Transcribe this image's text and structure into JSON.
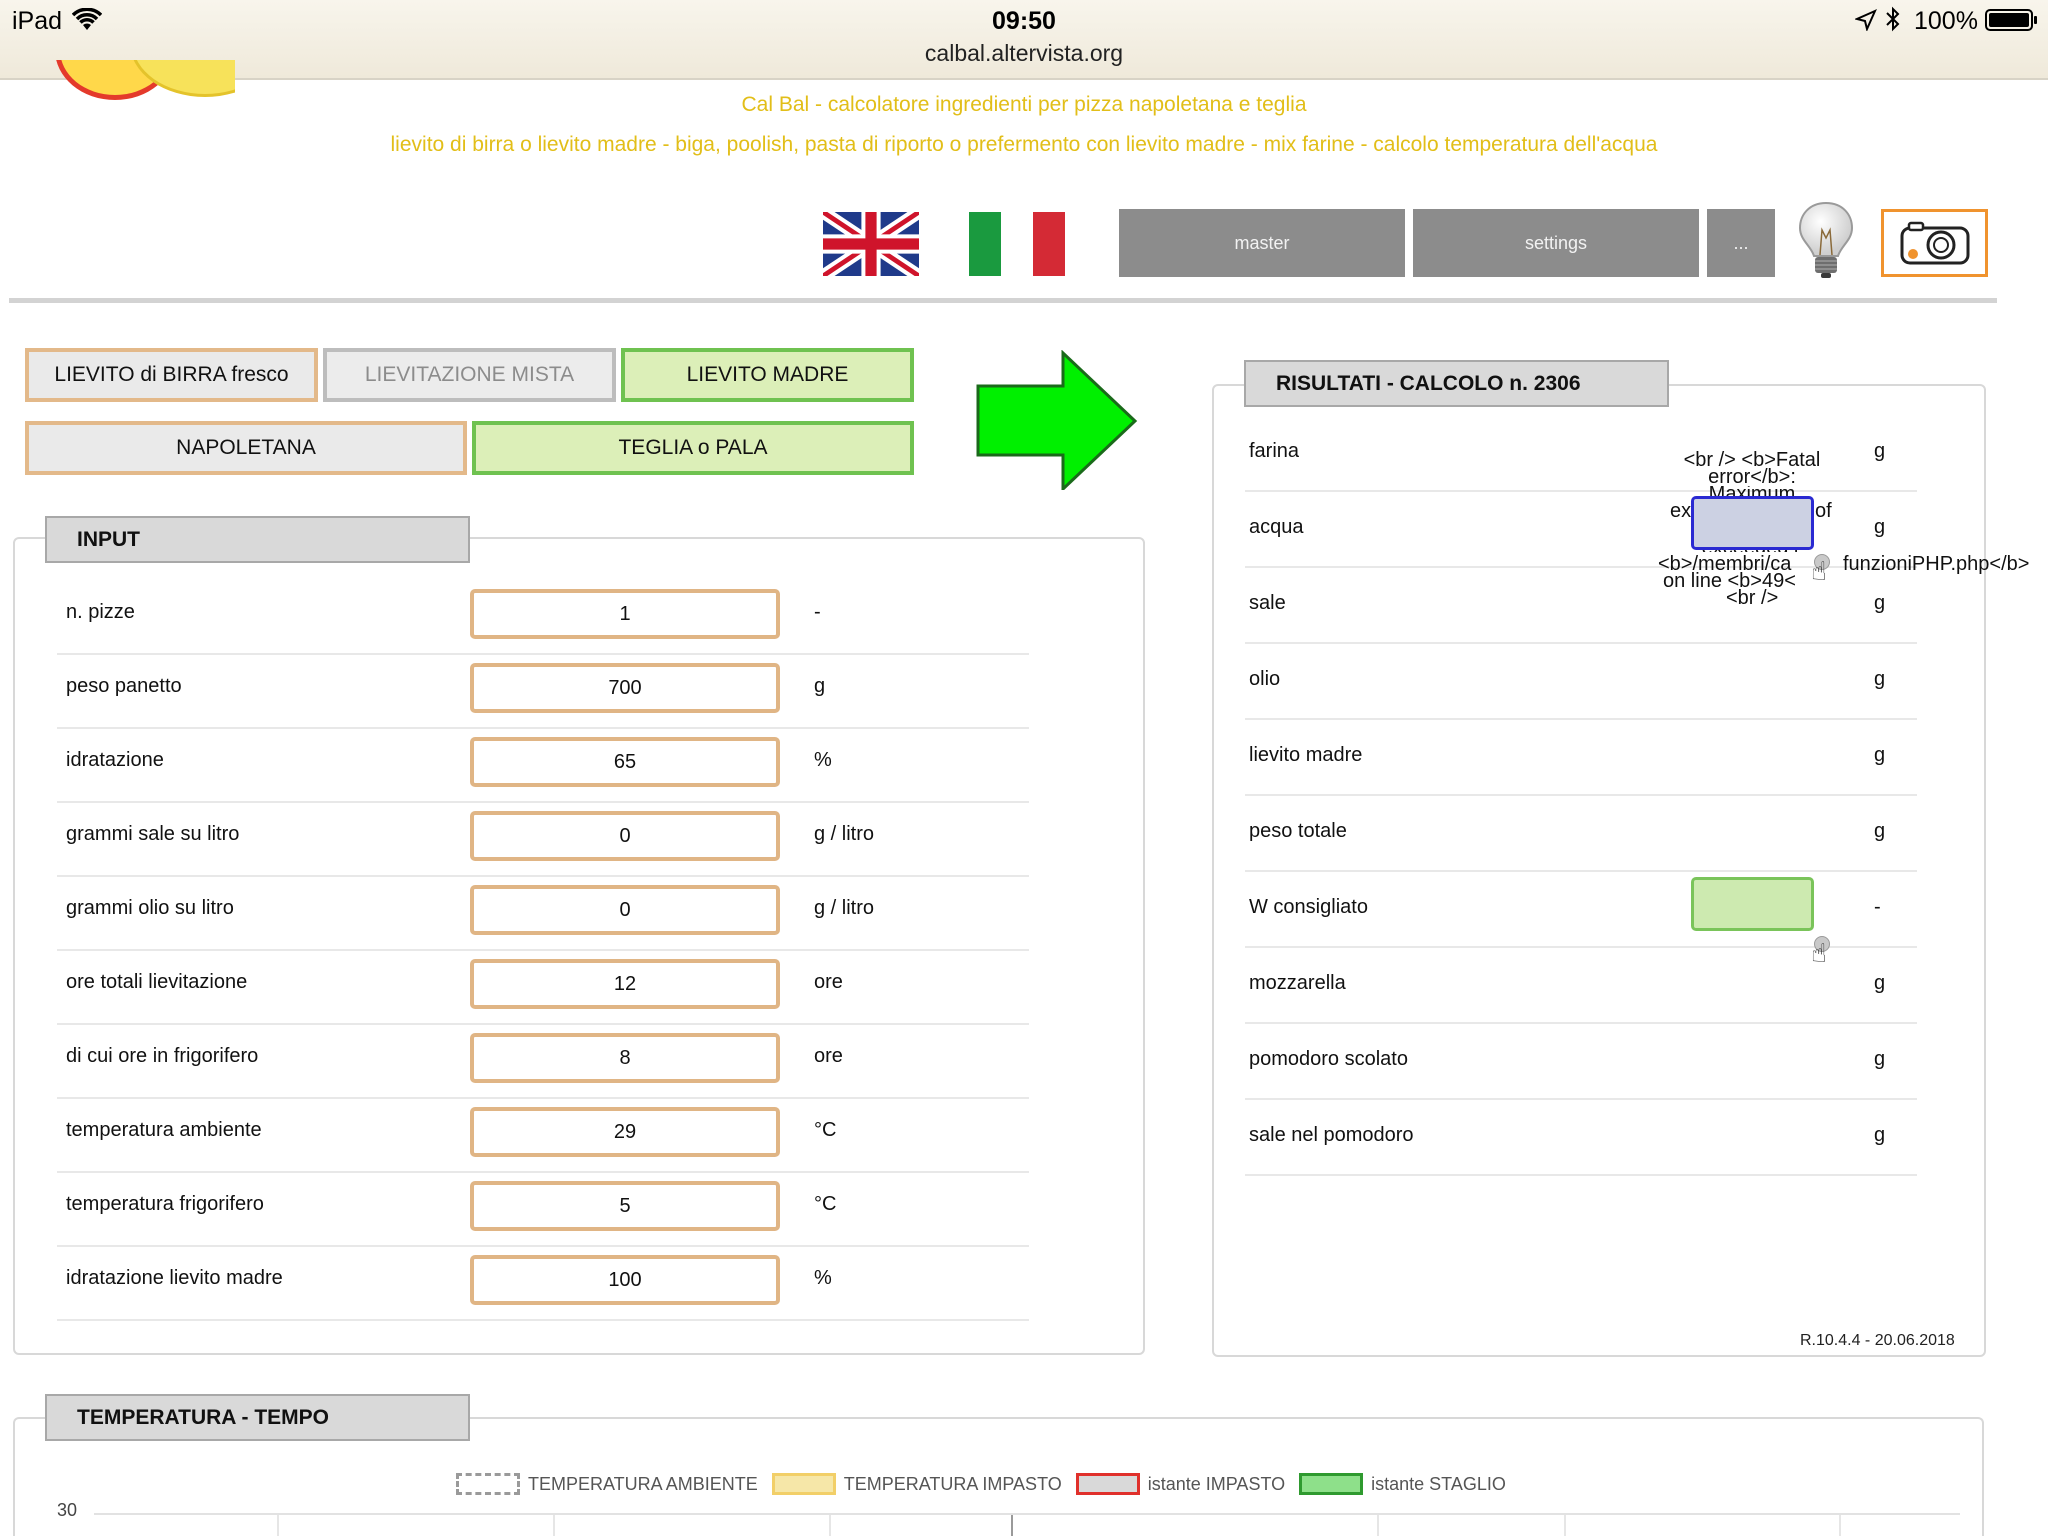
{
  "status_bar": {
    "device": "iPad",
    "time": "09:50",
    "url": "calbal.altervista.org",
    "battery": "100%"
  },
  "header": {
    "title": "Cal Bal - calcolatore ingredienti per pizza napoletana e teglia",
    "subtitle": "lievito di birra o lievito madre - biga, poolish, pasta di riporto o prefermento con lievito madre - mix farine - calcolo temperatura dell'acqua",
    "nav": {
      "master": "master",
      "settings": "settings",
      "more": "..."
    }
  },
  "modes": {
    "lievito_birra": "LIEVITO di BIRRA fresco",
    "lievitazione_mista": "LIEVITAZIONE MISTA",
    "lievito_madre": "LIEVITO MADRE",
    "napoletana": "NAPOLETANA",
    "teglia_pala": "TEGLIA o PALA"
  },
  "input": {
    "title": "INPUT",
    "rows": [
      {
        "label": "n. pizze",
        "value": "1",
        "unit": "-"
      },
      {
        "label": "peso panetto",
        "value": "700",
        "unit": "g"
      },
      {
        "label": "idratazione",
        "value": "65",
        "unit": "%"
      },
      {
        "label": "grammi sale su litro",
        "value": "0",
        "unit": "g / litro"
      },
      {
        "label": "grammi olio su litro",
        "value": "0",
        "unit": "g / litro"
      },
      {
        "label": "ore totali lievitazione",
        "value": "12",
        "unit": "ore"
      },
      {
        "label": "di cui ore in frigorifero",
        "value": "8",
        "unit": "ore"
      },
      {
        "label": "temperatura ambiente",
        "value": "29",
        "unit": "°C"
      },
      {
        "label": "temperatura frigorifero",
        "value": "5",
        "unit": "°C"
      },
      {
        "label": "idratazione lievito madre",
        "value": "100",
        "unit": "%"
      }
    ]
  },
  "results": {
    "title": "RISULTATI - CALCOLO n. 2306",
    "rows": [
      {
        "label": "farina",
        "unit": "g"
      },
      {
        "label": "acqua",
        "unit": "g"
      },
      {
        "label": "sale",
        "unit": "g"
      },
      {
        "label": "olio",
        "unit": "g"
      },
      {
        "label": "lievito madre",
        "unit": "g"
      },
      {
        "label": "peso totale",
        "unit": "g"
      },
      {
        "label": "W consigliato",
        "unit": "-"
      },
      {
        "label": "mozzarella",
        "unit": "g"
      },
      {
        "label": "pomodoro scolato",
        "unit": "g"
      },
      {
        "label": "sale nel pomodoro",
        "unit": "g"
      }
    ],
    "error_text": {
      "line1": "<br /> <b>Fatal",
      "line2": "error</b>:",
      "line3": "Maximum",
      "line4_left": "ex",
      "line4_right": "of",
      "line5": "exceeded i",
      "line6_left": "<b>/membri/ca",
      "line6_right": "funzioniPHP.php</b>",
      "line7": "on line <b>49<",
      "line8": "<br />"
    },
    "version": "R.10.4.4 - 20.06.2018"
  },
  "temp_chart": {
    "title": "TEMPERATURA - TEMPO",
    "legend": [
      {
        "label": "TEMPERATURA AMBIENTE",
        "color": "#9a9a9a"
      },
      {
        "label": "TEMPERATURA IMPASTO",
        "color": "#f6e7a8"
      },
      {
        "label": "istante IMPASTO",
        "color": "#d9d9d9"
      },
      {
        "label": "istante STAGLIO",
        "color": "#8ee08a"
      }
    ],
    "y_tick_top": "30"
  }
}
